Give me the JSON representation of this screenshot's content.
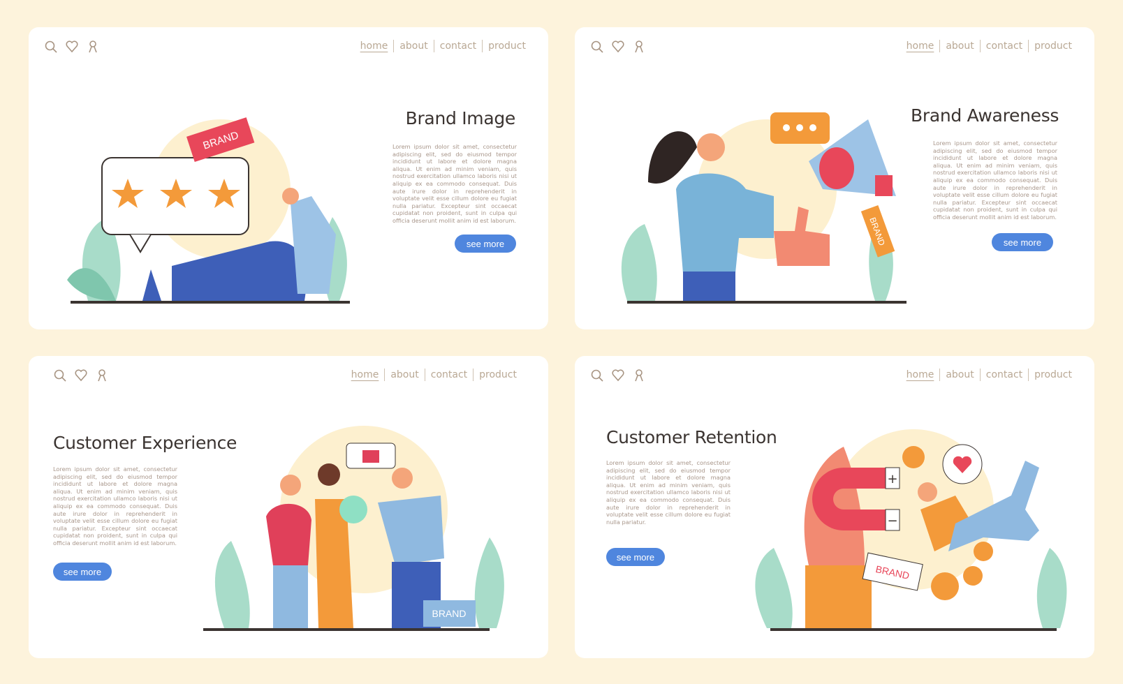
{
  "colors": {
    "background": "#fdf3dc",
    "card": "#ffffff",
    "button": "#4f86de",
    "nav_text": "#b9a894",
    "title": "#3b3431",
    "accent_red": "#e8475a",
    "accent_orange": "#f39a3a",
    "leaf": "#9ed8c4"
  },
  "nav": {
    "items": [
      "home",
      "about",
      "contact",
      "product"
    ],
    "icons": [
      "search-icon",
      "heart-icon",
      "user-icon"
    ]
  },
  "cards": [
    {
      "title": "Brand Image",
      "body": "Lorem ipsum dolor sit amet, consectetur adipiscing elit, sed do eiusmod tempor incididunt ut labore et dolore magna aliqua. Ut enim ad minim veniam, quis nostrud exercitation ullamco laboris nisi ut aliquip ex ea commodo consequat. Duis aute irure dolor in reprehenderit in voluptate velit esse cillum dolore eu fugiat nulla pariatur. Excepteur sint occaecat cupidatat non proident, sunt in culpa qui officia deserunt mollit anim id est laborum.",
      "button": "see more",
      "tag": "BRAND",
      "rating_stars": 3
    },
    {
      "title": "Brand Awareness",
      "body": "Lorem ipsum dolor sit amet, consectetur adipiscing elit, sed do eiusmod tempor incididunt ut labore et dolore magna aliqua. Ut enim ad minim veniam, quis nostrud exercitation ullamco laboris nisi ut aliquip ex ea commodo consequat. Duis aute irure dolor in reprehenderit in voluptate velit esse cillum dolore eu fugiat nulla pariatur. Excepteur sint occaecat cupidatat non proident, sunt in culpa qui officia deserunt mollit anim id est laborum.",
      "button": "see more",
      "tag": "BRAND"
    },
    {
      "title": "Customer Experience",
      "body": "Lorem ipsum dolor sit amet, consectetur adipiscing elit, sed do eiusmod tempor incididunt ut labore et dolore magna aliqua. Ut enim ad minim veniam, quis nostrud exercitation ullamco laboris nisi ut aliquip ex ea commodo consequat. Duis aute irure dolor in reprehenderit in voluptate velit esse cillum dolore eu fugiat nulla pariatur. Excepteur sint occaecat cupidatat non proident, sunt in culpa qui officia deserunt mollit anim id est laborum.",
      "button": "see more",
      "tag": "BRAND"
    },
    {
      "title": "Customer Retention",
      "body": "Lorem ipsum dolor sit amet, consectetur adipiscing elit, sed do eiusmod tempor incididunt ut labore et dolore magna aliqua. Ut enim ad minim veniam, quis nostrud exercitation ullamco laboris nisi ut aliquip ex ea commodo consequat. Duis aute irure dolor in reprehenderit in voluptate velit esse cillum dolore eu fugiat nulla pariatur.",
      "button": "see more",
      "tag": "BRAND"
    }
  ]
}
